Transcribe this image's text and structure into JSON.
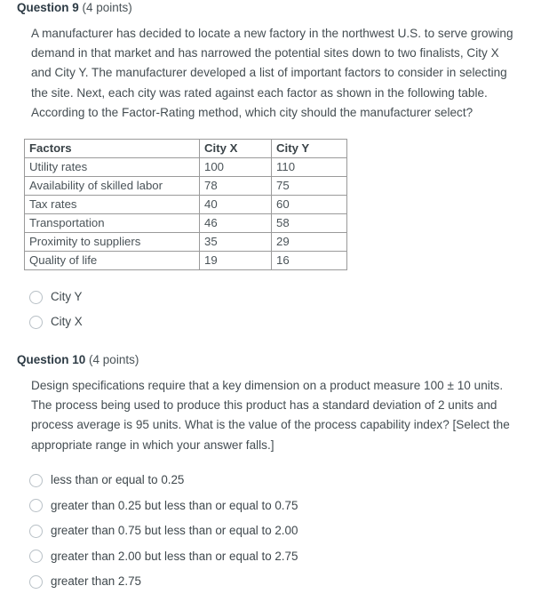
{
  "questions": [
    {
      "title": "Question 9",
      "points": "(4 points)",
      "body": "A manufacturer has decided to locate a new factory in the northwest U.S. to serve growing demand in that market and has narrowed the potential sites down to two finalists, City X and City Y. The manufacturer developed a list of important factors to consider in selecting the site. Next, each city was rated against each factor as shown in the following table. According to the Factor-Rating method, which city should the manufacturer select?",
      "table": {
        "headers": [
          "Factors",
          "City X",
          "City Y"
        ],
        "rows": [
          [
            "Utility rates",
            "100",
            "110"
          ],
          [
            "Availability of skilled labor",
            "78",
            "75"
          ],
          [
            "Tax rates",
            "40",
            "60"
          ],
          [
            "Transportation",
            "46",
            "58"
          ],
          [
            "Proximity to suppliers",
            "35",
            "29"
          ],
          [
            "Quality of life",
            "19",
            "16"
          ]
        ]
      },
      "options": [
        "City Y",
        "City X"
      ]
    },
    {
      "title": "Question 10",
      "points": "(4 points)",
      "body": "Design specifications require that a key dimension on a product measure 100 ± 10 units. The process being used to produce this product has a standard deviation of 2 units and process average is 95 units. What is the value of the process capability index? [Select the appropriate range in which your answer falls.]",
      "options": [
        "less than or equal to 0.25",
        "greater than 0.25 but less than or equal to 0.75",
        "greater than 0.75 but less than or equal to 2.00",
        "greater than 2.00 but less than or equal to 2.75",
        "greater than 2.75"
      ]
    }
  ]
}
